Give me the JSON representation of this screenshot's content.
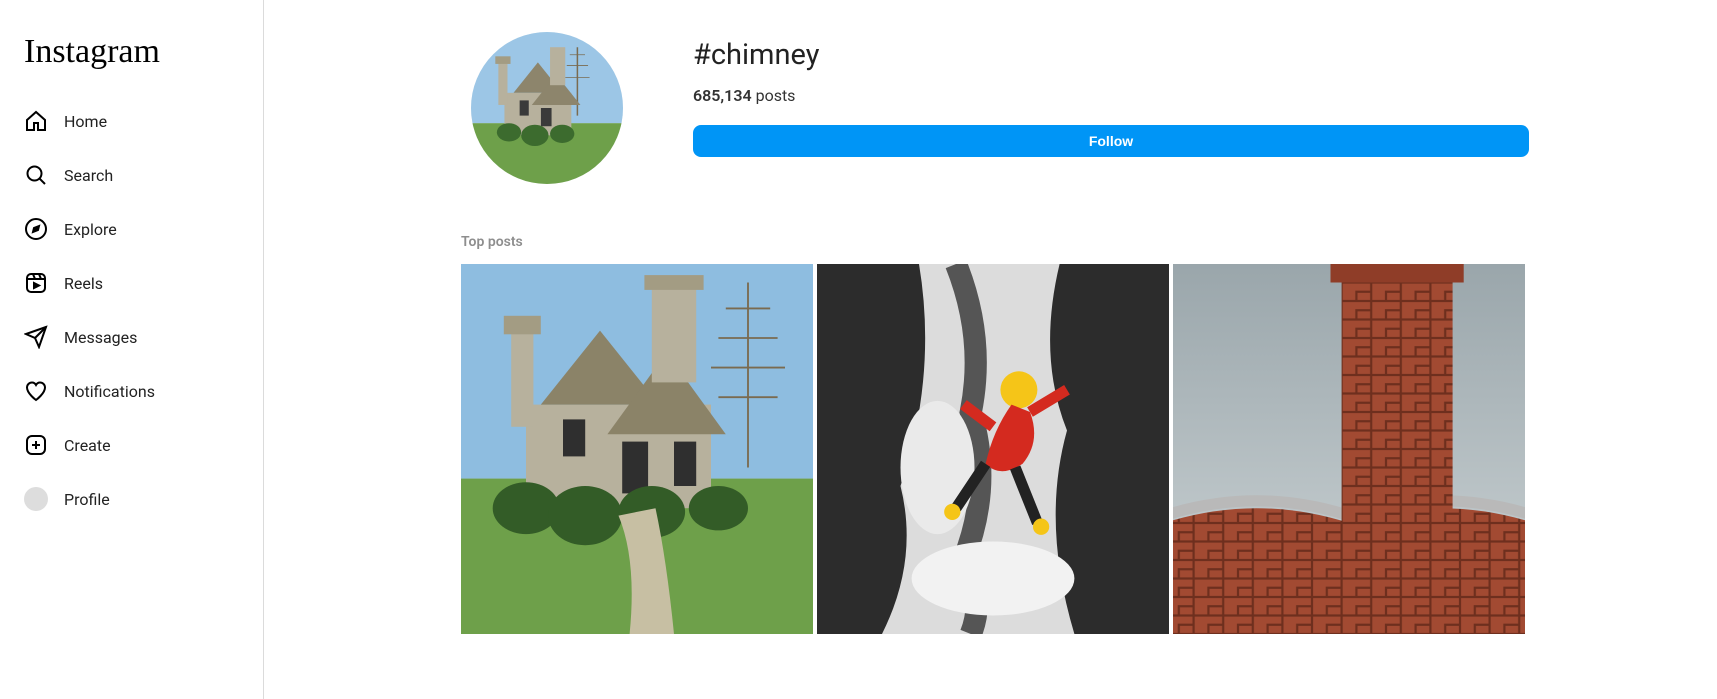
{
  "brand": "Instagram",
  "sidebar": {
    "items": [
      {
        "label": "Home"
      },
      {
        "label": "Search"
      },
      {
        "label": "Explore"
      },
      {
        "label": "Reels"
      },
      {
        "label": "Messages"
      },
      {
        "label": "Notifications"
      },
      {
        "label": "Create"
      },
      {
        "label": "Profile"
      }
    ]
  },
  "hashtag": {
    "title": "#chimney",
    "post_count": "685,134",
    "post_label": "posts",
    "follow_label": "Follow"
  },
  "section": {
    "top_posts_label": "Top posts"
  },
  "posts": [
    {
      "alt": "Stone cottage with chimneys"
    },
    {
      "alt": "Climber in red jacket on icy rock chimney"
    },
    {
      "alt": "Brick chimney against sky"
    }
  ]
}
